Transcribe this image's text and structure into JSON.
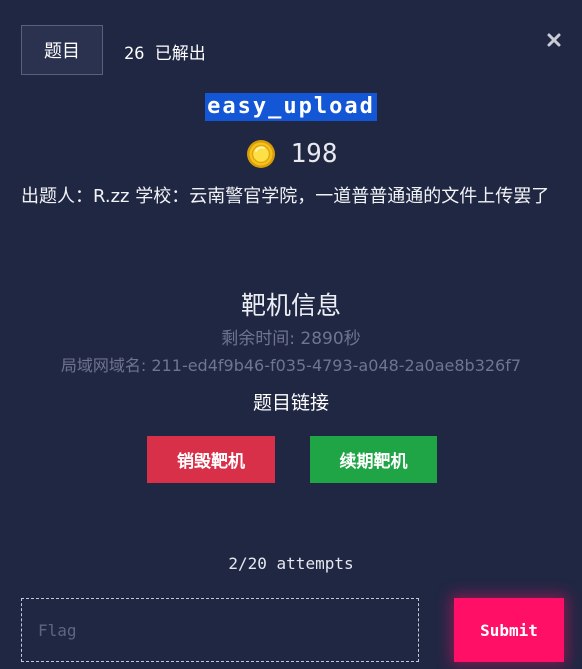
{
  "header": {
    "tab_label": "题目",
    "solves": "26 已解出",
    "close_icon": "close-icon"
  },
  "challenge": {
    "title": "easy_upload",
    "points": "198",
    "coin_icon": "coin-icon",
    "description": "出题人：R.zz 学校：云南警官学院，一道普普通通的文件上传罢了"
  },
  "target": {
    "section_title": "靶机信息",
    "remaining": "剩余时间: 2890秒",
    "domain": "局域网域名: 211-ed4f9b46-f035-4793-a048-2a0ae8b326f7",
    "link_label": "题目链接",
    "destroy_label": "销毁靶机",
    "renew_label": "续期靶机"
  },
  "submission": {
    "attempts": "2/20 attempts",
    "flag_placeholder": "Flag",
    "flag_value": "",
    "submit_label": "Submit"
  },
  "colors": {
    "background": "#202743",
    "title_highlight": "#1457d6",
    "destroy": "#d9304a",
    "renew": "#1fa546",
    "submit": "#ff0f66"
  }
}
